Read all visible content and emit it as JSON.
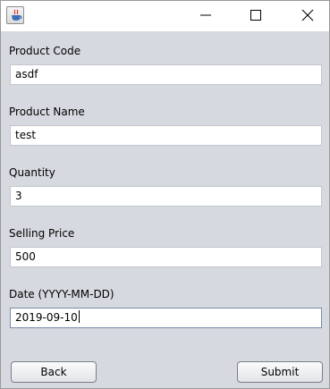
{
  "window": {
    "icon": "java-cup-icon",
    "controls": [
      "minimize-icon",
      "maximize-icon",
      "close-icon"
    ]
  },
  "form": {
    "fields": [
      {
        "label": "Product Code",
        "value": "asdf"
      },
      {
        "label": "Product Name",
        "value": "test"
      },
      {
        "label": "Quantity",
        "value": "3"
      },
      {
        "label": "Selling Price",
        "value": "500"
      },
      {
        "label": "Date (YYYY-MM-DD)",
        "value": "2019-09-10"
      }
    ]
  },
  "buttons": {
    "back_label": "Back",
    "submit_label": "Submit"
  },
  "colors": {
    "panel_background": "#d6d9df",
    "field_border": "#c2c5cb",
    "focused_border": "#7a8ba8"
  }
}
